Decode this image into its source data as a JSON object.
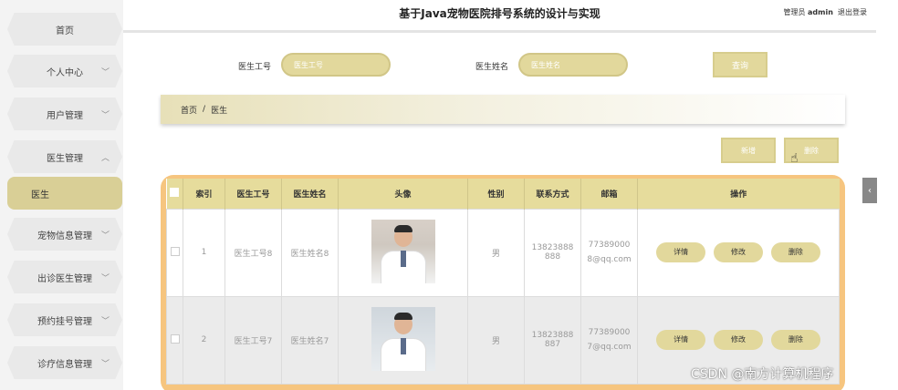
{
  "sidebar": {
    "items": [
      {
        "label": "首页",
        "chevron": ""
      },
      {
        "label": "个人中心",
        "chevron": "﹀"
      },
      {
        "label": "用户管理",
        "chevron": "﹀"
      },
      {
        "label": "医生管理",
        "chevron": "︿"
      },
      {
        "label": "医生",
        "chevron": ""
      },
      {
        "label": "宠物信息管理",
        "chevron": "﹀"
      },
      {
        "label": "出诊医生管理",
        "chevron": "﹀"
      },
      {
        "label": "预约挂号管理",
        "chevron": "﹀"
      },
      {
        "label": "诊疗信息管理",
        "chevron": "﹀"
      }
    ]
  },
  "header": {
    "title": "基于Java宠物医院排号系统的设计与实现",
    "role": "管理员",
    "username": "admin",
    "logout": "退出登录"
  },
  "search": {
    "doctor_id_label": "医生工号",
    "doctor_id_placeholder": "医生工号",
    "doctor_name_label": "医生姓名",
    "doctor_name_placeholder": "医生姓名",
    "query_label": "查询"
  },
  "breadcrumb": {
    "home": "首页",
    "sep": "/",
    "current": "医生"
  },
  "actions": {
    "add": "新增",
    "delete": "删除"
  },
  "table": {
    "headers": [
      "索引",
      "医生工号",
      "医生姓名",
      "头像",
      "性别",
      "联系方式",
      "邮箱",
      "操作"
    ],
    "rows": [
      {
        "index": "1",
        "doctor_id": "医生工号8",
        "doctor_name": "医生姓名8",
        "gender": "男",
        "phone": "13823888888",
        "email": "773890008@qq.com"
      },
      {
        "index": "2",
        "doctor_id": "医生工号7",
        "doctor_name": "医生姓名7",
        "gender": "男",
        "phone": "13823888887",
        "email": "773890007@qq.com"
      }
    ],
    "ops": {
      "detail": "详情",
      "edit": "修改",
      "delete": "删除"
    }
  },
  "watermark": "CSDN @南方计算机程序",
  "colors": {
    "accent": "#e2d89c",
    "table_border": "#f6c57f",
    "active_side": "#d9cf96"
  }
}
